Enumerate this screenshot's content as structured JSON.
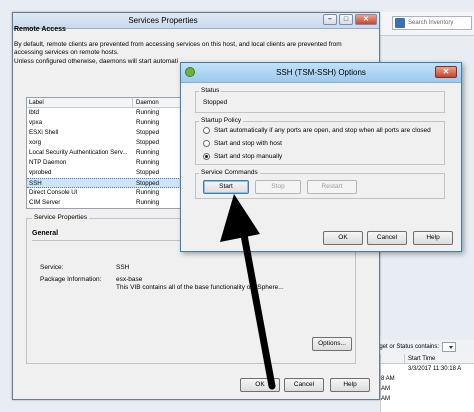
{
  "background_app": {
    "search_placeholder": "Search Inventory",
    "filter_label": "arget or Status contains:",
    "table_headers": [
      "",
      "Start Time"
    ],
    "table_rows": [
      [
        "",
        "3/3/2017 11:30:18 A"
      ],
      [
        "8 AM",
        ""
      ],
      [
        "AM",
        ""
      ],
      [
        "AM",
        ""
      ]
    ]
  },
  "services_dialog": {
    "title": "Services Properties",
    "remote_access_header": "Remote Access",
    "remote_access_desc": "By default, remote clients are prevented from accessing services on this host, and local clients are prevented from accessing services on remote hosts.",
    "remote_access_note": "Unless configured otherwise, daemons will start automati",
    "list_headers": {
      "label": "Label",
      "daemon": "Daemon"
    },
    "services": [
      {
        "label": "lbtd",
        "status": "Running",
        "selected": false
      },
      {
        "label": "vpxa",
        "status": "Running",
        "selected": false
      },
      {
        "label": "ESXi Shell",
        "status": "Stopped",
        "selected": false
      },
      {
        "label": "xorg",
        "status": "Stopped",
        "selected": false
      },
      {
        "label": "Local Security Authentication Serv...",
        "status": "Running",
        "selected": false
      },
      {
        "label": "NTP Daemon",
        "status": "Running",
        "selected": false
      },
      {
        "label": "vprobed",
        "status": "Stopped",
        "selected": false
      },
      {
        "label": "SSH",
        "status": "Stopped",
        "selected": true
      },
      {
        "label": "Direct Console UI",
        "status": "Running",
        "selected": false
      },
      {
        "label": "CIM Server",
        "status": "Running",
        "selected": false
      }
    ],
    "service_properties_label": "Service Properties",
    "general_header": "General",
    "service_key": "Service:",
    "service_value": "SSH",
    "package_key": "Package Information:",
    "package_value": "esx-base",
    "package_desc": "This VIB contains all of the base functionality of vSphere...",
    "options_button": "Options...",
    "ok_button": "OK",
    "cancel_button": "Cancel",
    "help_button": "Help"
  },
  "ssh_dialog": {
    "title": "SSH (TSM-SSH) Options",
    "status_label": "Status",
    "status_value": "Stopped",
    "startup_policy_label": "Startup Policy",
    "policies": [
      {
        "label": "Start automatically if any ports are open, and stop when all ports are closed",
        "selected": false
      },
      {
        "label": "Start and stop with host",
        "selected": false
      },
      {
        "label": "Start and stop manually",
        "selected": true
      }
    ],
    "service_commands_label": "Service Commands",
    "start_button": "Start",
    "stop_button": "Stop",
    "restart_button": "Restart",
    "ok_button": "OK",
    "cancel_button": "Cancel",
    "help_button": "Help"
  },
  "colors": {
    "accent_blue": "#3c7fb1",
    "selection": "#cfe3f7",
    "close_red": "#c8442c"
  }
}
